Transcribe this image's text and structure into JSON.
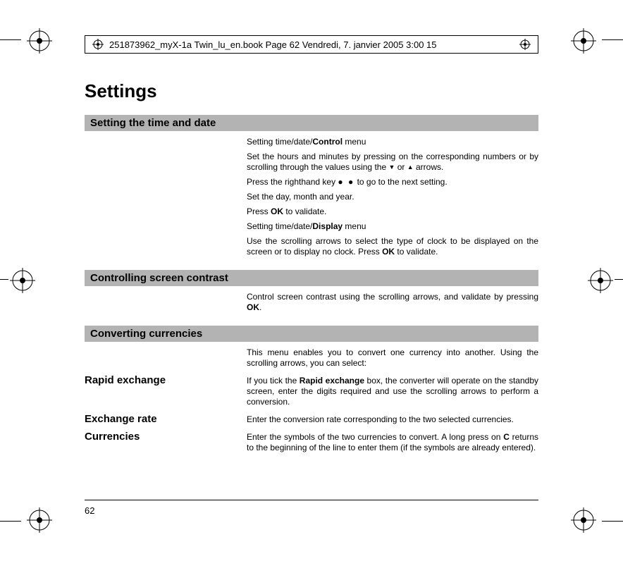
{
  "header_line": "251873962_myX-1a Twin_lu_en.book  Page 62  Vendredi, 7. janvier 2005  3:00 15",
  "page_number": "62",
  "title": "Settings",
  "sections": {
    "s1": {
      "bar": "Setting the time and date",
      "p1a": "Setting time/date/",
      "p1b": "Control",
      "p1c": " menu",
      "p2a": "Set the hours and minutes by pressing on the corresponding numbers or by scrolling through the values using the ",
      "p2b": " or ",
      "p2c": " arrows.",
      "p3a": "Press the righthand key ",
      "p3b": " to go to the next setting.",
      "p4": "Set the day, month and year.",
      "p5a": "Press ",
      "p5b": "OK",
      "p5c": " to validate.",
      "p6a": "Setting time/date/",
      "p6b": "Display",
      "p6c": " menu",
      "p7a": "Use the scrolling arrows to select the type of clock to be displayed on the screen or to display no clock. Press ",
      "p7b": "OK",
      "p7c": " to validate."
    },
    "s2": {
      "bar": "Controlling screen contrast",
      "p1a": "Control screen contrast using the scrolling arrows, and validate by pressing ",
      "p1b": "OK",
      "p1c": "."
    },
    "s3": {
      "bar": "Converting currencies",
      "intro": "This menu enables you to convert one currency into another. Using the scrolling arrows, you can select:",
      "r1_label": "Rapid exchange",
      "r1a": "If you tick the ",
      "r1b": "Rapid exchange",
      "r1c": " box, the converter will operate on the standby screen, enter the digits required and use the scrolling arrows to perform a conversion.",
      "r2_label": "Exchange rate",
      "r2": "Enter the conversion rate corresponding to the two selected currencies.",
      "r3_label": "Currencies",
      "r3a": "Enter the symbols of the two currencies to convert. A long press on ",
      "r3b": "C",
      "r3c": " returns to the beginning of the line to enter them (if the symbols are already entered)."
    }
  }
}
